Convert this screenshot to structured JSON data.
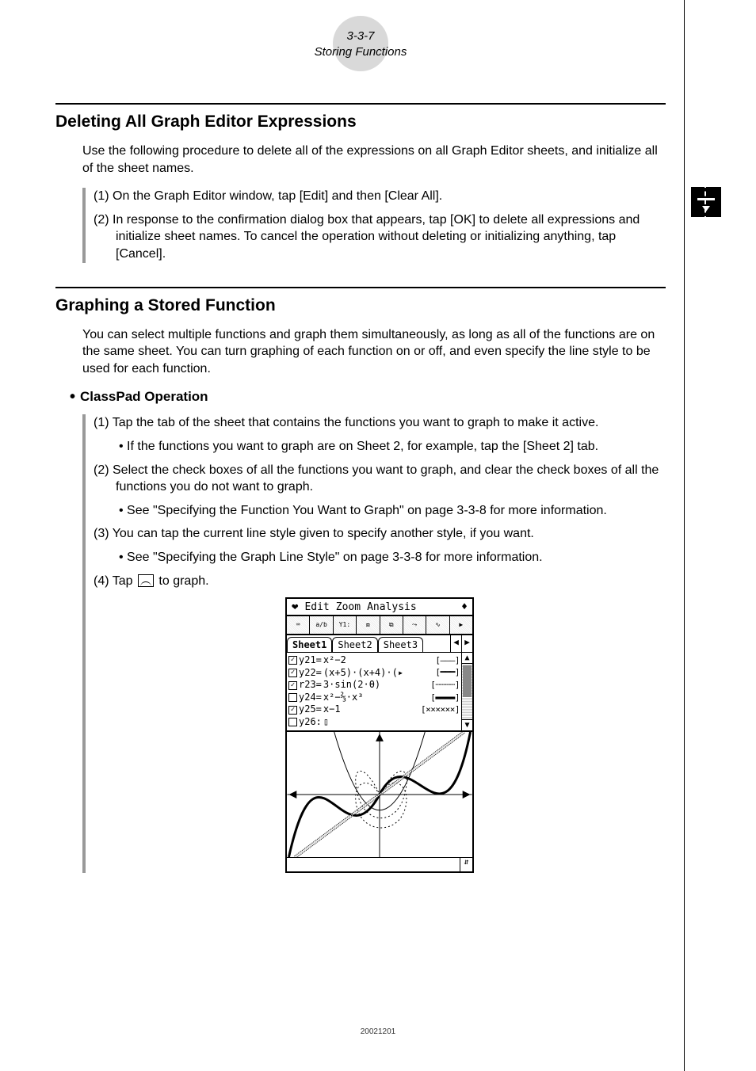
{
  "header": {
    "page_ref": "3-3-7",
    "section": "Storing Functions"
  },
  "sectionA": {
    "title": "Deleting All Graph Editor Expressions",
    "intro": "Use the following procedure to delete all of the expressions on all Graph Editor sheets, and initialize all of the sheet names.",
    "steps": [
      "(1) On the Graph Editor window, tap [Edit] and then [Clear All].",
      "(2) In response to the confirmation dialog box that appears, tap [OK] to delete all expressions and initialize sheet names. To cancel the operation without deleting or initializing anything, tap [Cancel]."
    ]
  },
  "sectionB": {
    "title": "Graphing a Stored Function",
    "intro": "You can select multiple functions and graph them simultaneously, as long as all of the functions are on the same sheet. You can turn graphing of each function on or off, and even specify the line style to be used for each function.",
    "subheading": "ClassPad Operation",
    "steps": {
      "s1": "(1) Tap the tab of the sheet that contains the functions you want to graph to make it active.",
      "s1b": "• If the functions you want to graph are on Sheet 2, for example, tap the [Sheet 2] tab.",
      "s2": "(2) Select the check boxes of all the functions you want to graph, and clear the check boxes of all the functions you do not want to graph.",
      "s2b": "• See \"Specifying the Function You Want to Graph\" on page 3-3-8 for more information.",
      "s3": "(3) You can tap the current line style given to specify another style, if you want.",
      "s3b": "• See \"Specifying the Graph Line Style\" on page 3-3-8 for more information.",
      "s4a": "(4) Tap ",
      "s4b": " to graph."
    }
  },
  "screenshot": {
    "menus": {
      "edit": "Edit",
      "zoom": "Zoom",
      "analysis": "Analysis"
    },
    "tabs": {
      "t1": "Sheet1",
      "t2": "Sheet2",
      "t3": "Sheet3"
    },
    "funcs": [
      {
        "chk": true,
        "lbl": "y21=",
        "expr": "x²−2",
        "ls": "[———]"
      },
      {
        "chk": true,
        "lbl": "y22=",
        "expr": "(x+5)·(x+4)·(▸",
        "ls": "[━━━]"
      },
      {
        "chk": true,
        "lbl": "r23=",
        "expr": "3·sin(2·θ)",
        "ls": "[┄┄┄┄]"
      },
      {
        "chk": false,
        "lbl": "y24=",
        "expr": "x²−⅔·x³",
        "ls": "[▬▬▬▬]"
      },
      {
        "chk": true,
        "lbl": "y25=",
        "expr": "x−1",
        "ls": "[××××××]"
      },
      {
        "chk": false,
        "lbl": "y26:",
        "expr": "▯",
        "ls": ""
      }
    ]
  },
  "footer": {
    "code": "20021201"
  }
}
